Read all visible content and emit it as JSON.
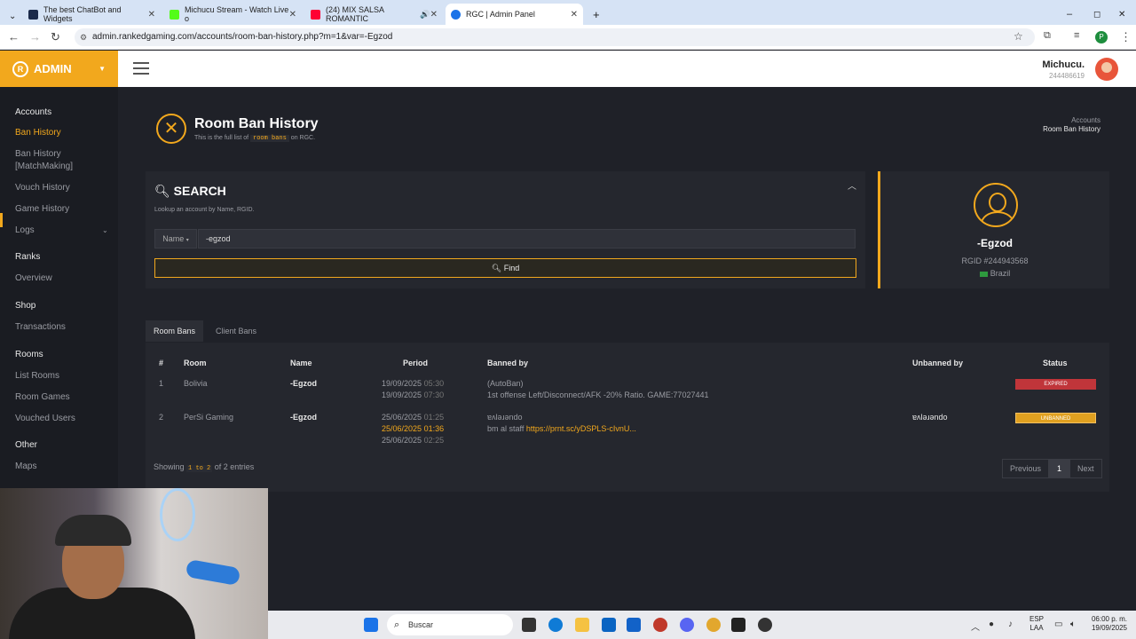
{
  "browser": {
    "tabs": [
      {
        "title": "The best ChatBot and Widgets",
        "color": "#1b2a4a"
      },
      {
        "title": "Michucu Stream - Watch Live o",
        "color": "#53fc18"
      },
      {
        "title": "(24) MIX SALSA ROMANTIC",
        "color": "#ff0033"
      },
      {
        "title": "RGC | Admin Panel",
        "color": "#1a73e8"
      }
    ],
    "url": "admin.rankedgaming.com/accounts/room-ban-history.php?m=1&var=-Egzod"
  },
  "brand": {
    "label": "ADMIN"
  },
  "user": {
    "name": "Michucu.",
    "id": "244486619"
  },
  "sidebar": {
    "sections": [
      {
        "title": "Accounts",
        "items": [
          "Ban History",
          "Ban History [MatchMaking]",
          "Vouch History",
          "Game History",
          "Logs"
        ]
      },
      {
        "title": "Ranks",
        "items": [
          "Overview"
        ]
      },
      {
        "title": "Shop",
        "items": [
          "Transactions"
        ]
      },
      {
        "title": "Rooms",
        "items": [
          "List Rooms",
          "Room Games",
          "Vouched Users"
        ]
      },
      {
        "title": "Other",
        "items": [
          "Maps"
        ]
      }
    ],
    "active": "Ban History"
  },
  "page": {
    "title": "Room Ban History",
    "subtitle_pre": "This is the full list of",
    "subtitle_code": "room bans",
    "subtitle_post": "on RGC.",
    "breadcrumb": [
      "Accounts",
      "Room Ban History"
    ]
  },
  "search": {
    "title": "SEARCH",
    "subtitle": "Lookup an account by Name, RGID.",
    "field_type": "Name",
    "value": "-egzod",
    "button": "Find"
  },
  "profile": {
    "name": "-Egzod",
    "rgid": "RGID #244943568",
    "country": "Brazil"
  },
  "tabs": [
    "Room Bans",
    "Client Bans"
  ],
  "table": {
    "headers": [
      "#",
      "Room",
      "Name",
      "Period",
      "Banned by",
      "Unbanned by",
      "Status"
    ],
    "rows": [
      {
        "num": "1",
        "room": "Bolivia",
        "name": "-Egzod",
        "period": [
          {
            "date": "19/09/2025",
            "time": "05:30"
          },
          {
            "date": "19/09/2025",
            "time": "07:30"
          }
        ],
        "banned_by": "(AutoBan)",
        "reason": "1st offense Left/Disconnect/AFK -20% Ratio. GAME:77027441",
        "reason_link": "",
        "unbanned_by": "",
        "status": "EXPIRED",
        "status_color": "#c0353a"
      },
      {
        "num": "2",
        "room": "PerSi Gaming",
        "name": "-Egzod",
        "period": [
          {
            "date": "25/06/2025",
            "time": "01:25"
          },
          {
            "date": "25/06/2025",
            "time": "01:36"
          },
          {
            "date": "25/06/2025",
            "time": "02:25"
          }
        ],
        "banned_by": "ɐʌlǝɹǝndo",
        "reason": "bm al staff ",
        "reason_link": "https://prnt.sc/yDSPLS-cIvnU...",
        "unbanned_by": "ɐʌlǝɹǝndo",
        "status": "UNBANNED",
        "status_color": "#e0a020"
      }
    ],
    "entries_pre": "Showing",
    "entries_code": "1 to 2",
    "entries_post": "of 2 entries",
    "pager": [
      "Previous",
      "1",
      "Next"
    ]
  },
  "taskbar": {
    "search": "Buscar",
    "lang": [
      "ESP",
      "LAA"
    ],
    "time": "06:00 p. m.",
    "date": "19/09/2025"
  }
}
